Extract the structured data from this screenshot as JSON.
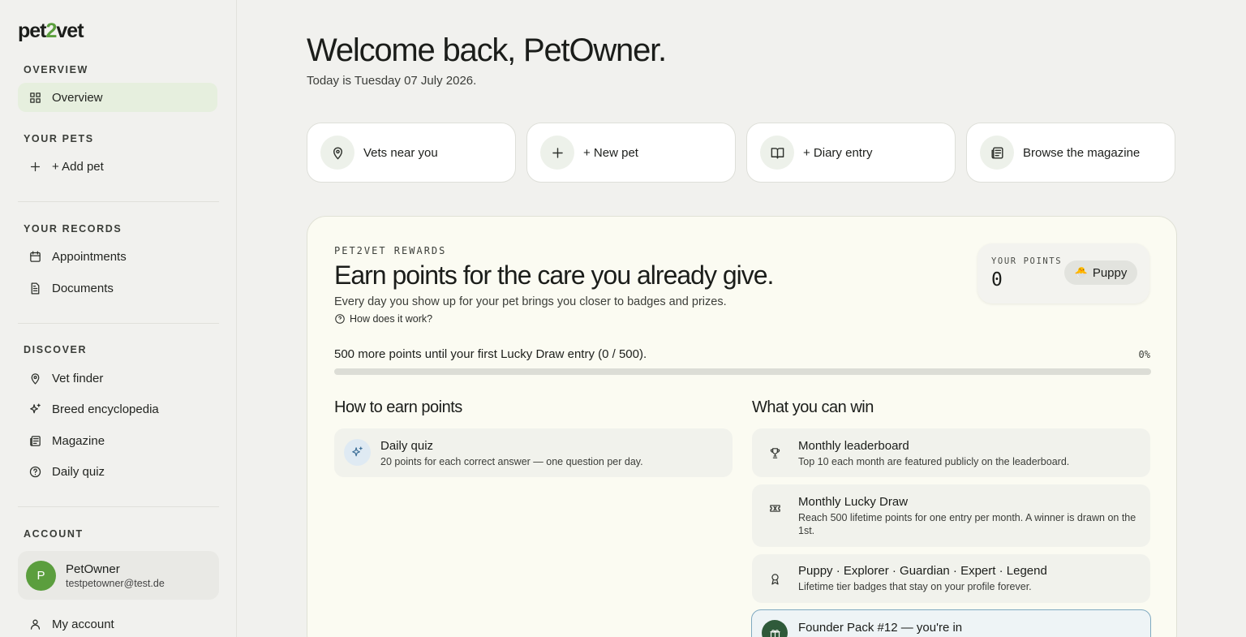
{
  "brand": {
    "logo_pre": "pet",
    "logo_mid": "2",
    "logo_post": "vet",
    "accent": "#5b9e3e"
  },
  "sidebar": {
    "overview_title": "OVERVIEW",
    "overview_item": "Overview",
    "pets_title": "YOUR PETS",
    "add_pet": "+ Add pet",
    "records_title": "YOUR RECORDS",
    "appointments": "Appointments",
    "documents": "Documents",
    "discover_title": "DISCOVER",
    "vet_finder": "Vet finder",
    "breed_encyclopedia": "Breed encyclopedia",
    "magazine": "Magazine",
    "daily_quiz": "Daily quiz",
    "account_title": "ACCOUNT",
    "account_initial": "P",
    "account_name": "PetOwner",
    "account_email": "testpetowner@test.de",
    "my_account": "My account"
  },
  "header": {
    "welcome": "Welcome back, PetOwner.",
    "today": "Today is Tuesday 07 July 2026."
  },
  "quick_actions": {
    "vets": "Vets near you",
    "new_pet": "+ New pet",
    "diary": "+ Diary entry",
    "magazine": "Browse the magazine"
  },
  "rewards": {
    "kicker": "PET2VET REWARDS",
    "title": "Earn points for the care you already give.",
    "subtitle": "Every day you show up for your pet brings you closer to badges and prizes.",
    "how_link": "How does it work?",
    "points_label": "YOUR POINTS",
    "points_value": "0",
    "tier_emoji": "🐣",
    "tier_name": "Puppy",
    "progress_text": "500 more points until your first Lucky Draw entry (0 / 500).",
    "progress_pct_label": "0%",
    "progress_fraction": 0,
    "earn_title": "How to earn points",
    "earn_items": [
      {
        "title": "Daily quiz",
        "desc": "20 points for each correct answer — one question per day."
      }
    ],
    "win_title": "What you can win",
    "win_items": [
      {
        "title": "Monthly leaderboard",
        "desc": "Top 10 each month are featured publicly on the leaderboard."
      },
      {
        "title": "Monthly Lucky Draw",
        "desc": "Reach 500 lifetime points for one entry per month. A winner is drawn on the 1st."
      },
      {
        "title": "Puppy · Explorer · Guardian · Expert · Legend",
        "desc": "Lifetime tier badges that stay on your profile forever."
      }
    ],
    "founder_title": "Founder Pack #12 — you're in"
  }
}
